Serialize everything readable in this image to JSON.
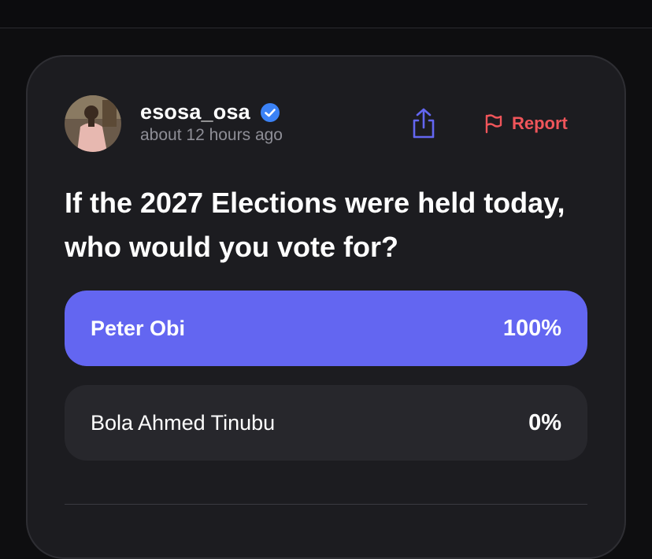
{
  "post": {
    "username": "esosa_osa",
    "verified": true,
    "timestamp": "about 12 hours ago",
    "report_label": "Report",
    "question": "If the 2027 Elections were held today, who would you vote for?"
  },
  "poll": {
    "options": [
      {
        "label": "Peter Obi",
        "percent_text": "100%",
        "share": 1.0
      },
      {
        "label": "Bola Ahmed Tinubu",
        "percent_text": "0%",
        "share": 0.0
      }
    ]
  },
  "colors": {
    "accent": "#6366f1",
    "report": "#f0555a",
    "verified": "#3b82f6",
    "share_icon": "#6366f1"
  },
  "icons": {
    "share": "share-icon",
    "report": "flag-icon",
    "verified": "verified-badge-icon"
  }
}
